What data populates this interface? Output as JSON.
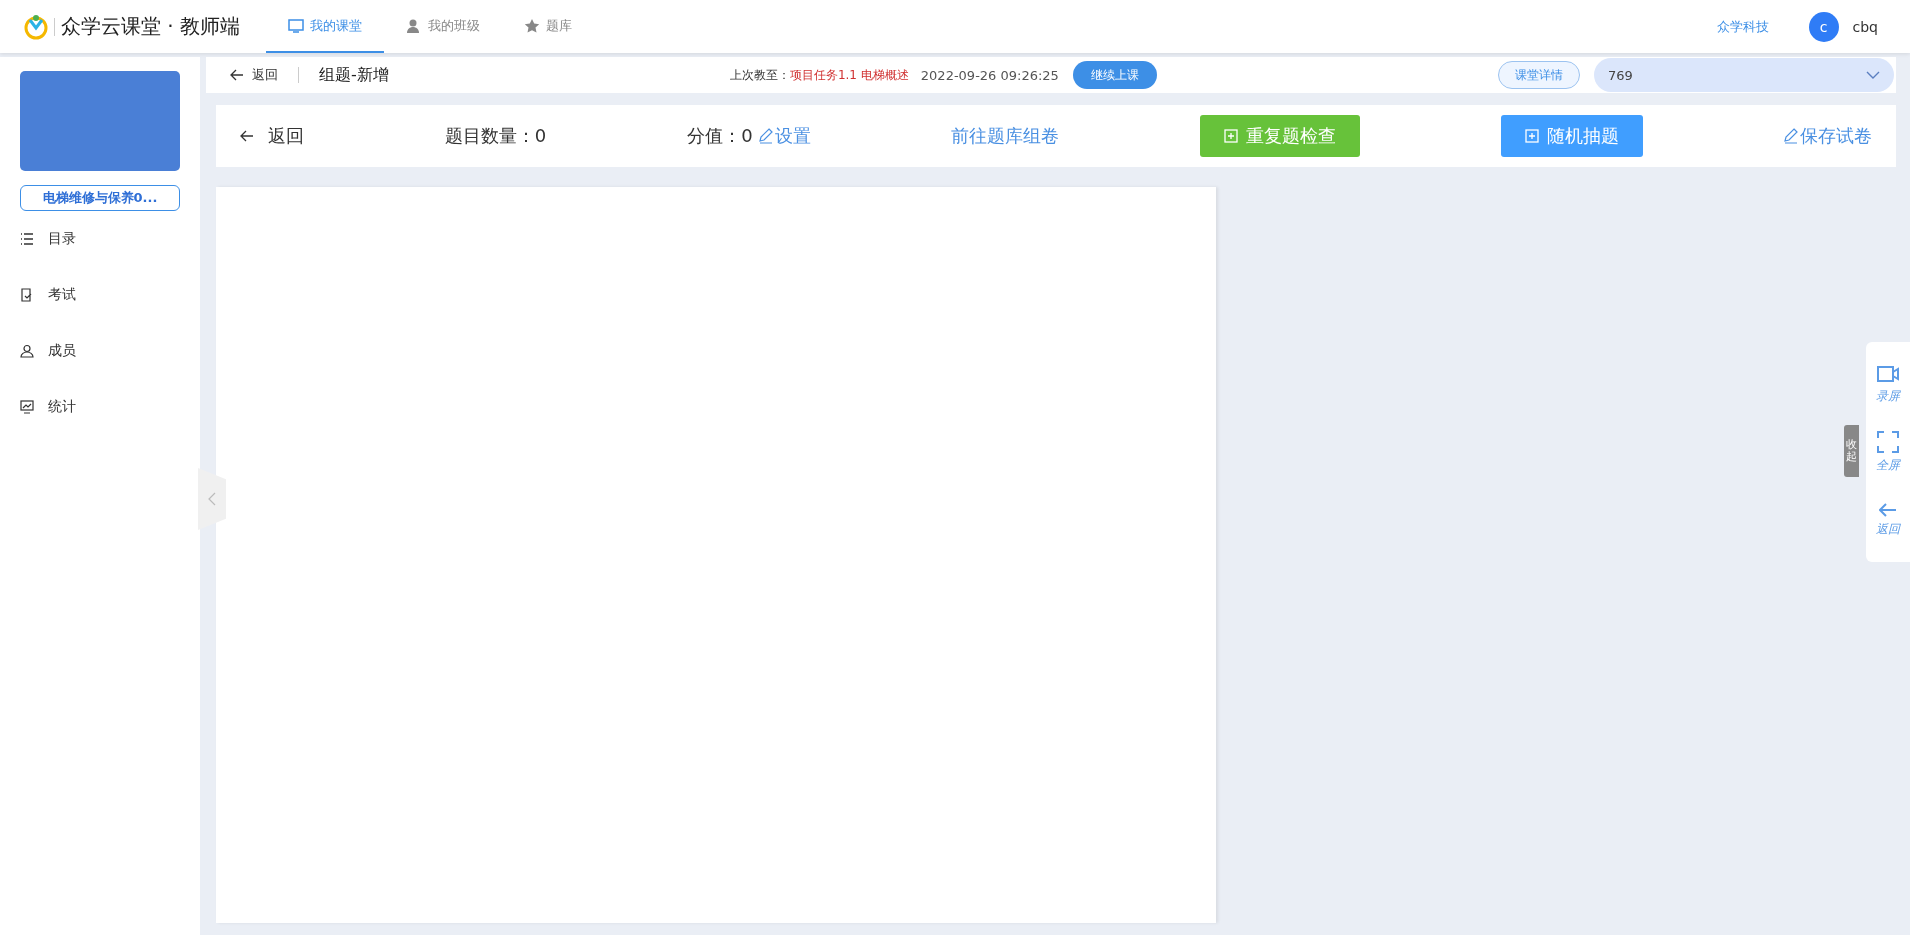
{
  "header": {
    "brand": "众学云课堂 · 教师端",
    "nav": [
      {
        "label": "我的课堂",
        "kind": "screen",
        "selected": true
      },
      {
        "label": "我的班级",
        "kind": "people",
        "selected": false
      },
      {
        "label": "题库",
        "kind": "star",
        "selected": false
      }
    ],
    "company": "众学科技",
    "avatar": "c",
    "user": "cbq"
  },
  "sidebar": {
    "course": "电梯维修与保养0...",
    "items": [
      {
        "label": "目录",
        "kind": "list"
      },
      {
        "label": "考试",
        "kind": "exam"
      },
      {
        "label": "成员",
        "kind": "user"
      },
      {
        "label": "统计",
        "kind": "chart"
      }
    ]
  },
  "subbar": {
    "back": "返回",
    "title": "组题-新增",
    "last_label": "上次教至：",
    "last_lesson": "项目任务1.1 电梯概述",
    "last_time": "2022-09-26 09:26:25",
    "continue": "继续上课",
    "details": "课堂详情",
    "class_select": "769"
  },
  "toolbar": {
    "back": "返回",
    "count": "题目数量：0",
    "score": "分值：0",
    "settings": "设置",
    "goto": "前往题库组卷",
    "buttons": [
      {
        "label": "重复题检查",
        "kind": "green"
      },
      {
        "label": "随机抽题",
        "kind": "blue"
      }
    ],
    "save": "保存试卷"
  },
  "collapse_tab": "收起",
  "side_tools": [
    {
      "label": "录屏",
      "kind": "record"
    },
    {
      "label": "全屏",
      "kind": "full"
    },
    {
      "label": "返回",
      "kind": "back"
    }
  ]
}
